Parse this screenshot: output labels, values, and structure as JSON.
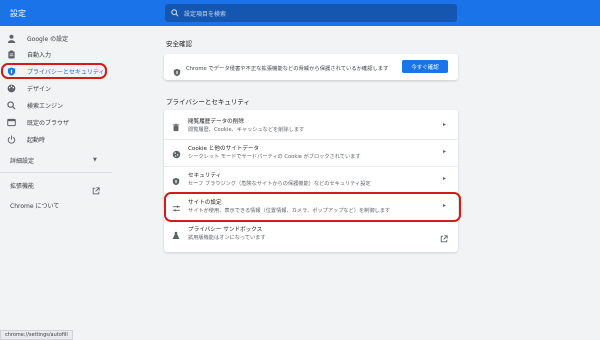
{
  "header": {
    "title": "設定",
    "search_placeholder": "設定項目を検索"
  },
  "sidebar": {
    "items": [
      {
        "label": "Google の設定",
        "icon": "person-icon"
      },
      {
        "label": "自動入力",
        "icon": "clipboard-icon"
      },
      {
        "label": "プライバシーとセキュリティ",
        "icon": "shield-icon",
        "active": true
      },
      {
        "label": "デザイン",
        "icon": "palette-icon"
      },
      {
        "label": "検索エンジン",
        "icon": "search-icon"
      },
      {
        "label": "既定のブラウザ",
        "icon": "browser-icon"
      },
      {
        "label": "起動時",
        "icon": "power-icon"
      }
    ],
    "advanced": "詳細設定",
    "extensions": "拡張機能",
    "about": "Chrome について"
  },
  "safety_check": {
    "section_title": "安全確認",
    "text": "Chrome でデータ侵害や不正な拡張機能などの脅威から保護されているか確認します",
    "button": "今すぐ確認"
  },
  "privacy": {
    "section_title": "プライバシーとセキュリティ",
    "rows": [
      {
        "title": "閲覧履歴データの削除",
        "subtitle": "閲覧履歴、Cookie、キャッシュなどを削除します",
        "icon": "trash-icon"
      },
      {
        "title": "Cookie と他のサイトデータ",
        "subtitle": "シークレット モードでサードパーティの Cookie がブロックされています",
        "icon": "cookie-icon"
      },
      {
        "title": "セキュリティ",
        "subtitle": "セーフ ブラウジング（危険なサイトからの保護機能）などのセキュリティ設定",
        "icon": "shield-icon"
      },
      {
        "title": "サイトの設定",
        "subtitle": "サイトが使用、表示できる情報（位置情報、カメラ、ポップアップなど）を制御します",
        "icon": "sliders-icon"
      },
      {
        "title": "プライバシー サンドボックス",
        "subtitle": "試用版機能はオンになっています",
        "icon": "flask-icon"
      }
    ]
  },
  "status_bar": "chrome://settings/autofill",
  "colors": {
    "accent": "#1a73e8",
    "highlight": "#d21c1c"
  }
}
